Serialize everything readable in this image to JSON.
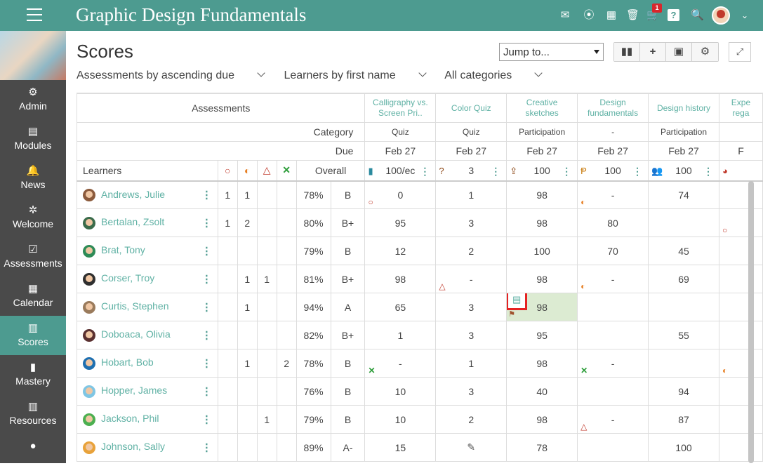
{
  "app": {
    "title": "Graphic Design Fundamentals",
    "cart_count": "1"
  },
  "sidebar": {
    "items": [
      {
        "label": "Admin",
        "icon": "gear-icon"
      },
      {
        "label": "Modules",
        "icon": "book-icon"
      },
      {
        "label": "News",
        "icon": "bell-icon"
      },
      {
        "label": "Welcome",
        "icon": "sun-icon"
      },
      {
        "label": "Assessments",
        "icon": "checkbox-icon"
      },
      {
        "label": "Calendar",
        "icon": "calendar-icon"
      },
      {
        "label": "Scores",
        "icon": "gradebook-icon",
        "active": true
      },
      {
        "label": "Mastery",
        "icon": "bar-chart-icon"
      },
      {
        "label": "Resources",
        "icon": "books-icon"
      },
      {
        "label": "",
        "icon": "user-icon"
      }
    ]
  },
  "page": {
    "title": "Scores",
    "jump_to": "Jump to...",
    "filters": {
      "sort_assessments": "Assessments by ascending due",
      "sort_learners": "Learners by first name",
      "categories": "All categories"
    }
  },
  "table": {
    "header": {
      "assessments": "Assessments",
      "category": "Category",
      "due": "Due",
      "learners": "Learners",
      "overall": "Overall"
    },
    "columns": [
      {
        "title": "Calligraphy vs. Screen Pri..",
        "category": "Quiz",
        "due": "Feb 27",
        "points": "100/ec",
        "icon": "book-icon",
        "color": "#2a8a9e"
      },
      {
        "title": "Color Quiz",
        "category": "Quiz",
        "due": "Feb 27",
        "points": "3",
        "icon": "question-icon",
        "color": "#8b4513"
      },
      {
        "title": "Creative sketches",
        "category": "Participation",
        "due": "Feb 27",
        "points": "100",
        "icon": "upload-icon",
        "color": "#8b4513"
      },
      {
        "title": "Design fundamentals",
        "category": "-",
        "due": "Feb 27",
        "points": "100",
        "icon": "discussion-icon",
        "color": "#c8790a"
      },
      {
        "title": "Design history",
        "category": "Participation",
        "due": "Feb 27",
        "points": "100",
        "icon": "group-icon",
        "color": "#2a8a9e"
      },
      {
        "title": "Expe rega",
        "category": "",
        "due": "F",
        "points": "",
        "icon": "pie-icon",
        "color": "#c0392b"
      }
    ],
    "rows": [
      {
        "name": "Andrews, Julie",
        "c1": "1",
        "c2": "1",
        "c3": "",
        "c4": "",
        "pct": "78%",
        "grade": "B",
        "s": [
          "0",
          "1",
          "98",
          "-",
          "74",
          ""
        ],
        "avatar": "#8b5a3c"
      },
      {
        "name": "Bertalan, Zsolt",
        "c1": "1",
        "c2": "2",
        "c3": "",
        "c4": "",
        "pct": "80%",
        "grade": "B+",
        "s": [
          "95",
          "3",
          "98",
          "80",
          "",
          ""
        ],
        "avatar": "#3a6b4a"
      },
      {
        "name": "Brat, Tony",
        "c1": "",
        "c2": "",
        "c3": "",
        "c4": "",
        "pct": "79%",
        "grade": "B",
        "s": [
          "12",
          "2",
          "100",
          "70",
          "45",
          ""
        ],
        "avatar": "#2e8b57"
      },
      {
        "name": "Corser, Troy",
        "c1": "",
        "c2": "1",
        "c3": "1",
        "c4": "",
        "pct": "81%",
        "grade": "B+",
        "s": [
          "98",
          "-",
          "98",
          "-",
          "69",
          ""
        ],
        "avatar": "#2f2f2f"
      },
      {
        "name": "Curtis, Stephen",
        "c1": "",
        "c2": "1",
        "c3": "",
        "c4": "",
        "pct": "94%",
        "grade": "A",
        "s": [
          "65",
          "3",
          "98",
          "",
          "",
          ""
        ],
        "avatar": "#9a7b5c"
      },
      {
        "name": "Doboaca, Olivia",
        "c1": "",
        "c2": "",
        "c3": "",
        "c4": "",
        "pct": "82%",
        "grade": "B+",
        "s": [
          "1",
          "3",
          "95",
          "",
          "55",
          ""
        ],
        "avatar": "#5a3030"
      },
      {
        "name": "Hobart, Bob",
        "c1": "",
        "c2": "1",
        "c3": "",
        "c4": "2",
        "pct": "78%",
        "grade": "B",
        "s": [
          "-",
          "1",
          "98",
          "-",
          "",
          ""
        ],
        "avatar": "#1e6fb0"
      },
      {
        "name": "Hopper, James",
        "c1": "",
        "c2": "",
        "c3": "",
        "c4": "",
        "pct": "76%",
        "grade": "B",
        "s": [
          "10",
          "3",
          "40",
          "",
          "94",
          ""
        ],
        "avatar": "#7fc6e4"
      },
      {
        "name": "Jackson, Phil",
        "c1": "",
        "c2": "",
        "c3": "1",
        "c4": "",
        "pct": "79%",
        "grade": "B",
        "s": [
          "10",
          "2",
          "98",
          "-",
          "87",
          ""
        ],
        "avatar": "#4caf50"
      },
      {
        "name": "Johnson, Sally",
        "c1": "",
        "c2": "",
        "c3": "",
        "c4": "",
        "pct": "89%",
        "grade": "A-",
        "s": [
          "15",
          "",
          "78",
          "",
          "100",
          ""
        ],
        "avatar": "#e8a23a"
      }
    ]
  }
}
